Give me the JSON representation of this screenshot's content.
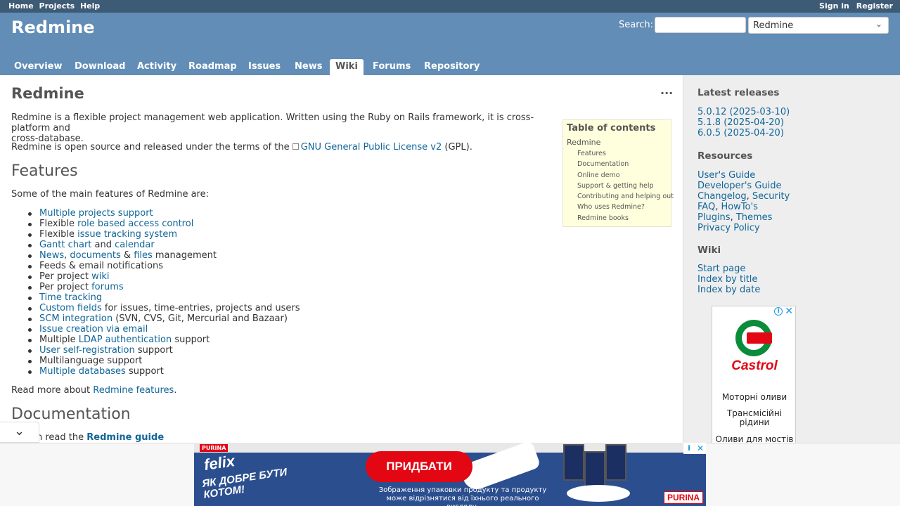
{
  "top_menu": {
    "left": [
      "Home",
      "Projects",
      "Help"
    ],
    "right": [
      "Sign in",
      "Register"
    ]
  },
  "header": {
    "title": "Redmine",
    "search_label": "Search:",
    "search_value": "",
    "project_select": "Redmine"
  },
  "main_menu": [
    "Overview",
    "Download",
    "Activity",
    "Roadmap",
    "Issues",
    "News",
    "Wiki",
    "Forums",
    "Repository"
  ],
  "selected_tab": "Wiki",
  "content": {
    "title": "Redmine",
    "intro1": "Redmine is a flexible project management web application. Written using the Ruby on Rails framework, it is cross-platform and",
    "intro1b": "cross-database.",
    "intro2_pre": "Redmine is open source and released under the terms of the",
    "intro2_link": "GNU General Public License v2",
    "intro2_post": "(GPL).",
    "features_heading": "Features",
    "features_intro": "Some of the main features of Redmine are:",
    "features": [
      {
        "pre": "",
        "link": "Multiple projects support",
        "post": ""
      },
      {
        "pre": "Flexible ",
        "link": "role based access control",
        "post": ""
      },
      {
        "pre": "Flexible ",
        "link": "issue tracking system",
        "post": ""
      },
      {
        "pre": "",
        "link": "Gantt chart",
        "post": " and ",
        "link2": "calendar"
      },
      {
        "pre": "",
        "link": "News",
        "post": ", ",
        "link2": "documents",
        "post2": " & ",
        "link3": "files",
        "post3": " management"
      },
      {
        "pre": "Feeds & email notifications",
        "link": "",
        "post": ""
      },
      {
        "pre": "Per project ",
        "link": "wiki",
        "post": ""
      },
      {
        "pre": "Per project ",
        "link": "forums",
        "post": ""
      },
      {
        "pre": "",
        "link": "Time tracking",
        "post": ""
      },
      {
        "pre": "",
        "link": "Custom fields",
        "post": " for issues, time-entries, projects and users"
      },
      {
        "pre": "",
        "link": "SCM integration",
        "post": " (SVN, CVS, Git, Mercurial and Bazaar)"
      },
      {
        "pre": "",
        "link": "Issue creation via email",
        "post": ""
      },
      {
        "pre": "Multiple ",
        "link": "LDAP authentication",
        "post": " support"
      },
      {
        "pre": "",
        "link": "User self-registration",
        "post": " support"
      },
      {
        "pre": "Multilanguage support",
        "link": "",
        "post": ""
      },
      {
        "pre": "",
        "link": "Multiple databases",
        "post": " support"
      }
    ],
    "read_more_pre": "Read more about",
    "read_more_link": "Redmine features",
    "read_more_post": ".",
    "documentation_heading": "Documentation",
    "doc_partial_pre": "n read the",
    "doc_partial_link": "Redmine guide",
    "actions_icon": "more-icon",
    "more_glyph": "···"
  },
  "toc": {
    "title": "Table of contents",
    "root": "Redmine",
    "items": [
      "Features",
      "Documentation",
      "Online demo",
      "Support & getting help",
      "Contributing and helping out",
      "Who uses Redmine?",
      "Redmine books"
    ]
  },
  "sidebar": {
    "latest_heading": "Latest releases",
    "releases": [
      "5.0.12 (2025-03-10)",
      "5.1.8 (2025-04-20)",
      "6.0.5 (2025-04-20)"
    ],
    "resources_heading": "Resources",
    "resources": [
      [
        "User's Guide"
      ],
      [
        "Developer's Guide"
      ],
      [
        "Changelog",
        "Security"
      ],
      [
        "FAQ",
        "HowTo's"
      ],
      [
        "Plugins",
        "Themes"
      ],
      [
        "Privacy Policy"
      ]
    ],
    "wiki_heading": "Wiki",
    "wiki_links": [
      "Start page",
      "Index by title",
      "Index by date"
    ]
  },
  "side_ad": {
    "brand": "Castrol",
    "line1": "Моторні оливи",
    "line2": "Трансмісійні рідини",
    "line3": "Оливи для мостів",
    "info_glyph": "i",
    "close_glyph": "✕"
  },
  "bottom_ad": {
    "purina_top": "PURINA",
    "brand": "felix",
    "slogan": "ЯК ДОБРЕ БУТИ КОТОМ!",
    "cta": "ПРИДБАТИ",
    "disclaimer": "Зображення упаковки продукту та продукту може відрізнятися від їхнього реального вигляду.",
    "purina_logo": "PURINA",
    "info_glyph": "i",
    "close_glyph": "✕"
  },
  "collapse_glyph": "⌄",
  "select_chevron": "⌄",
  "colors": {
    "top_menu_bg": "#3e5b76",
    "header_bg": "#628db6",
    "link": "#116699",
    "toc_bg": "#ffffdd",
    "sidebar_bg": "#eeeeee"
  }
}
